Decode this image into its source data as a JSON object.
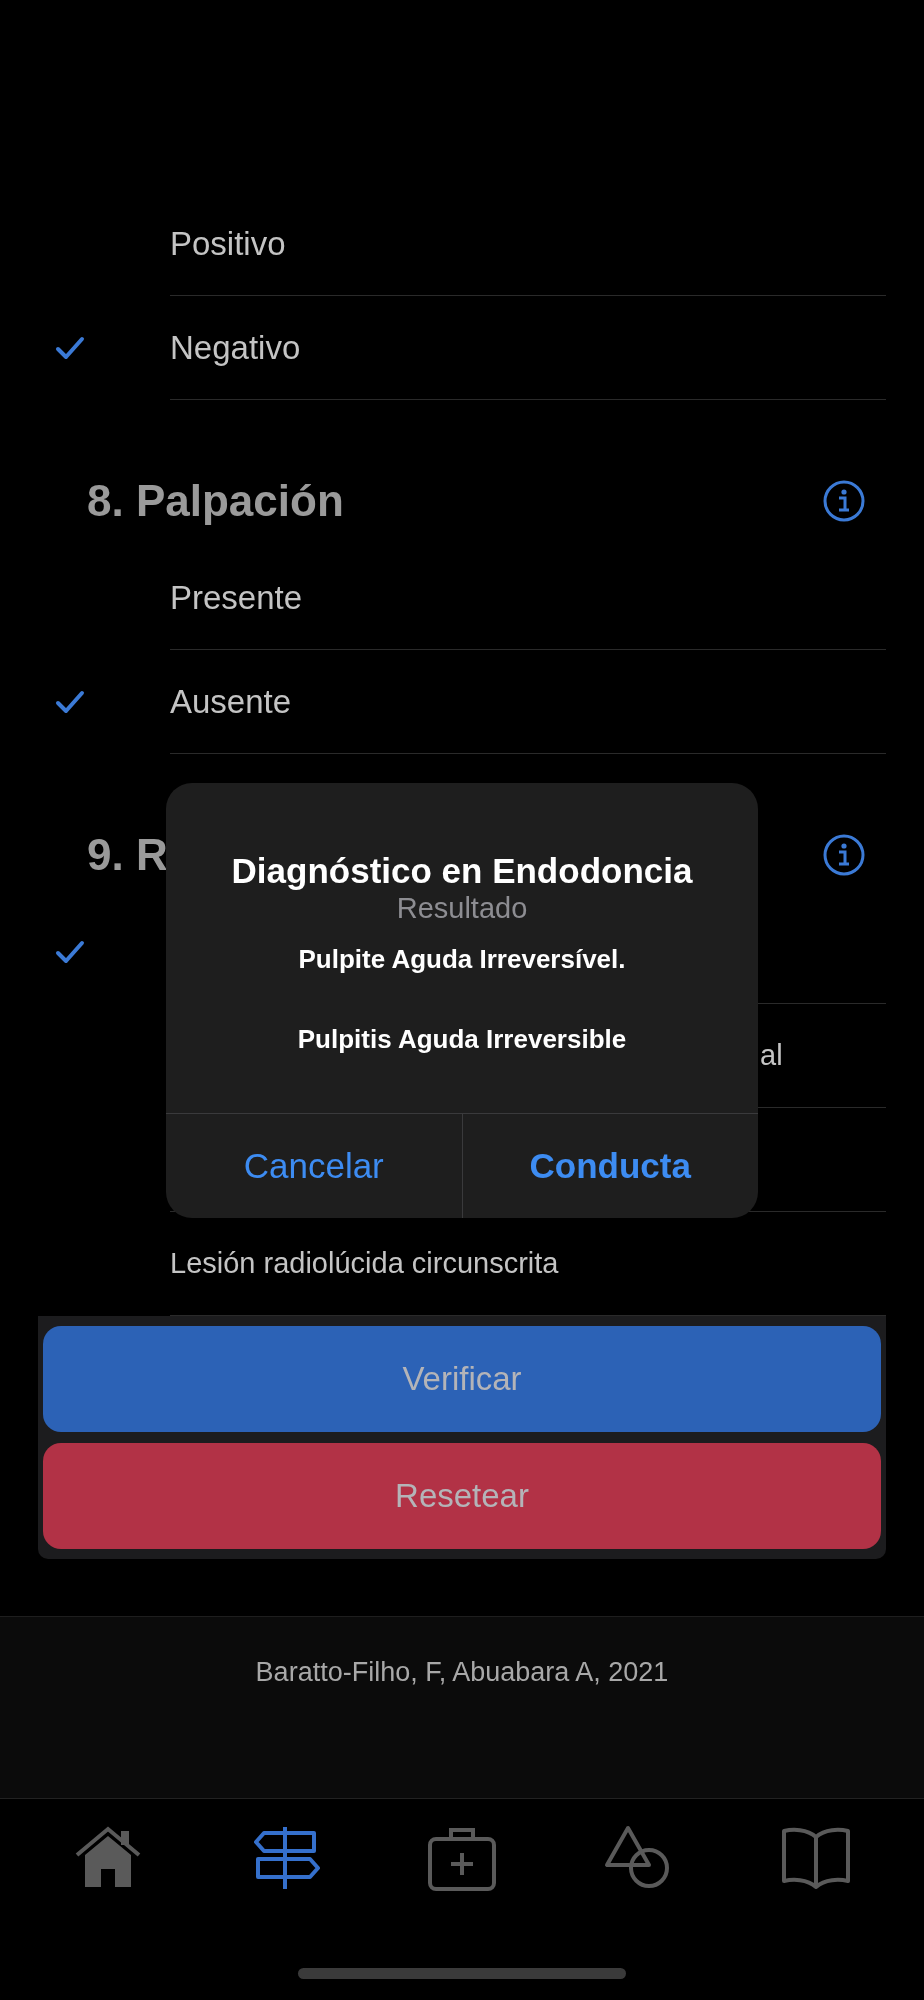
{
  "sections": [
    {
      "options": [
        {
          "label": "Positivo",
          "selected": false
        },
        {
          "label": "Negativo",
          "selected": true
        }
      ]
    },
    {
      "title": "8. Palpación",
      "options": [
        {
          "label": "Presente",
          "selected": false
        },
        {
          "label": "Ausente",
          "selected": true
        }
      ]
    },
    {
      "title": "9. R",
      "small": true,
      "options": [
        {
          "selected": true
        },
        {
          "label": "al",
          "kind": "clipped",
          "selected": false
        },
        {
          "selected": false
        },
        {
          "label": "Lesión radiolúcida circunscrita",
          "selected": false
        }
      ]
    }
  ],
  "actions": [
    {
      "label": "Verificar",
      "kind": "primary"
    },
    {
      "label": "Resetear",
      "kind": "danger"
    }
  ],
  "credit": "Baratto-Filho, F, Abuabara A, 2021",
  "tabs": [
    {
      "kind": "home",
      "selected": false
    },
    {
      "kind": "signpost",
      "selected": true
    },
    {
      "kind": "medkit",
      "selected": false
    },
    {
      "kind": "shapes",
      "selected": false
    },
    {
      "kind": "book",
      "selected": false
    }
  ],
  "dialog": {
    "title": "Diagnóstico en Endodoncia",
    "subtitle": "Resultado",
    "lines": [
      "Pulpite Aguda Irreversível.",
      "Pulpitis Aguda Irreversible"
    ],
    "buttons": [
      {
        "label": "Cancelar",
        "kind": "cancel"
      },
      {
        "label": "Conducta",
        "kind": "default"
      }
    ]
  }
}
